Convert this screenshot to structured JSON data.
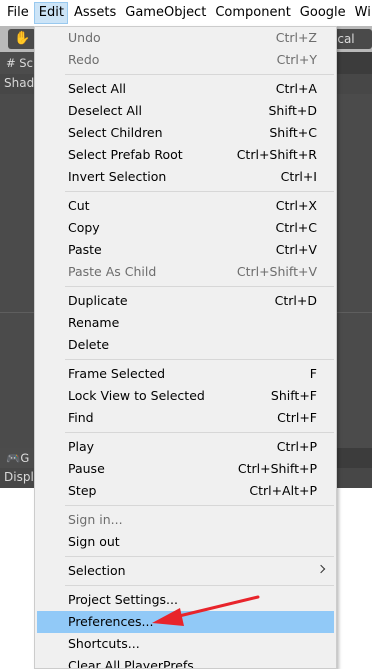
{
  "menubar": {
    "items": [
      "File",
      "Edit",
      "Assets",
      "GameObject",
      "Component",
      "Google",
      "Wir"
    ]
  },
  "background": {
    "toolbar_right": "ocal",
    "scene_tab": "# Sc",
    "shading": "Shad",
    "game_tab": "G",
    "display": "Displ"
  },
  "edit_menu": {
    "undo": {
      "label": "Undo",
      "shortcut": "Ctrl+Z"
    },
    "redo": {
      "label": "Redo",
      "shortcut": "Ctrl+Y"
    },
    "select_all": {
      "label": "Select All",
      "shortcut": "Ctrl+A"
    },
    "deselect_all": {
      "label": "Deselect All",
      "shortcut": "Shift+D"
    },
    "select_children": {
      "label": "Select Children",
      "shortcut": "Shift+C"
    },
    "select_prefab_root": {
      "label": "Select Prefab Root",
      "shortcut": "Ctrl+Shift+R"
    },
    "invert_selection": {
      "label": "Invert Selection",
      "shortcut": "Ctrl+I"
    },
    "cut": {
      "label": "Cut",
      "shortcut": "Ctrl+X"
    },
    "copy": {
      "label": "Copy",
      "shortcut": "Ctrl+C"
    },
    "paste": {
      "label": "Paste",
      "shortcut": "Ctrl+V"
    },
    "paste_as_child": {
      "label": "Paste As Child",
      "shortcut": "Ctrl+Shift+V"
    },
    "duplicate": {
      "label": "Duplicate",
      "shortcut": "Ctrl+D"
    },
    "rename": {
      "label": "Rename"
    },
    "delete": {
      "label": "Delete"
    },
    "frame_selected": {
      "label": "Frame Selected",
      "shortcut": "F"
    },
    "lock_view": {
      "label": "Lock View to Selected",
      "shortcut": "Shift+F"
    },
    "find": {
      "label": "Find",
      "shortcut": "Ctrl+F"
    },
    "play": {
      "label": "Play",
      "shortcut": "Ctrl+P"
    },
    "pause": {
      "label": "Pause",
      "shortcut": "Ctrl+Shift+P"
    },
    "step": {
      "label": "Step",
      "shortcut": "Ctrl+Alt+P"
    },
    "sign_in": {
      "label": "Sign in..."
    },
    "sign_out": {
      "label": "Sign out"
    },
    "selection": {
      "label": "Selection"
    },
    "project_settings": {
      "label": "Project Settings..."
    },
    "preferences": {
      "label": "Preferences..."
    },
    "shortcuts": {
      "label": "Shortcuts..."
    },
    "clear_player_prefs": {
      "label": "Clear All PlayerPrefs"
    }
  },
  "colors": {
    "highlight": "#91c9f7",
    "annotation_arrow": "#e8242b"
  }
}
